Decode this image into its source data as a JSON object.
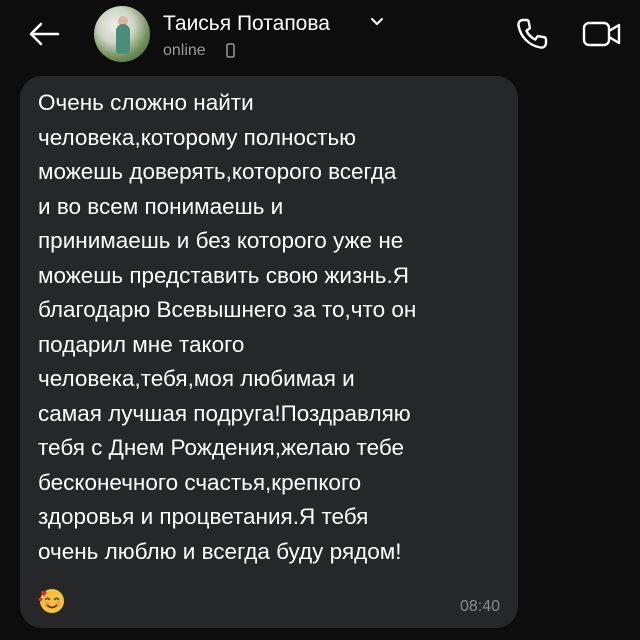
{
  "header": {
    "back_icon": "arrow-left-icon",
    "contact_name": "Таисья Потапова",
    "name_chevron_icon": "chevron-down-icon",
    "status": "online",
    "status_device_icon": "mobile-phone-icon",
    "call_icon": "phone-icon",
    "video_icon": "video-camera-icon"
  },
  "message": {
    "text": "Очень сложно найти\nчеловека,которому полностью\nможешь доверять,которого всегда\nи во всем понимаешь и\nпринимаешь и без которого уже не\nможешь представить свою жизнь.Я\nблагодарю Всевышнего за то,что он\nподарил мне такого\nчеловека,тебя,моя любимая и\nсамая лучшая подруга!Поздравляю\nтебя с Днем Рождения,желаю тебе\nбесконечного счастья,крепкого\nздоровья и процветания.Я тебя\nочень люблю и всегда буду рядом!",
    "emoji_icon": "smiling-face-with-hearts-icon",
    "time": "08:40"
  },
  "colors": {
    "background": "#0d0d0d",
    "bubble": "#262729",
    "text": "#ffffff",
    "muted": "#9a9a9a"
  }
}
